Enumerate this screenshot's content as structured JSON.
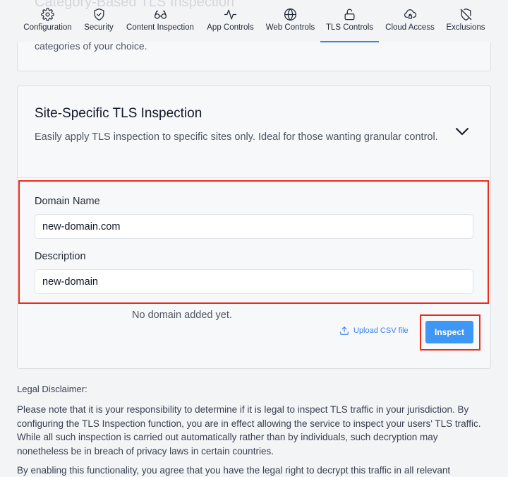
{
  "header": {
    "ghost_title": "Category-Based TLS Inspection"
  },
  "tabs": [
    {
      "label": "Configuration",
      "icon": "gear-icon"
    },
    {
      "label": "Security",
      "icon": "shield-check-icon"
    },
    {
      "label": "Content Inspection",
      "icon": "glasses-icon"
    },
    {
      "label": "App Controls",
      "icon": "activity-icon"
    },
    {
      "label": "Web Controls",
      "icon": "globe-icon"
    },
    {
      "label": "TLS Controls",
      "icon": "unlock-icon",
      "active": true
    },
    {
      "label": "Cloud Access",
      "icon": "cloud-lock-icon"
    },
    {
      "label": "Exclusions",
      "icon": "shield-off-icon"
    }
  ],
  "category_card": {
    "desc_tail": "categories of your choice."
  },
  "site_card": {
    "title": "Site-Specific TLS Inspection",
    "description": "Easily apply TLS inspection to specific sites only. Ideal for those wanting granular control.",
    "domain_label": "Domain Name",
    "domain_value": "new-domain.com",
    "description_label": "Description",
    "description_value": "new-domain",
    "empty_text": "No domain added yet.",
    "upload_label": "Upload CSV file",
    "inspect_label": "Inspect"
  },
  "legal": {
    "heading": "Legal Disclaimer:",
    "p1": "Please note that it is your responsibility to determine if it is legal to inspect TLS traffic in your jurisdiction. By configuring the TLS Inspection function, you are in effect allowing the service to inspect your users' TLS traffic. While all such inspection is carried out automatically rather than by individuals, such decryption may nonetheless be in breach of privacy laws in certain countries.",
    "p2": "By enabling this functionality, you agree that you have the legal right to decrypt this traffic in all relevant jurisdictions."
  },
  "colors": {
    "accent": "#3f97f5",
    "highlight": "#ee2b1b",
    "link": "#3b82f6"
  }
}
